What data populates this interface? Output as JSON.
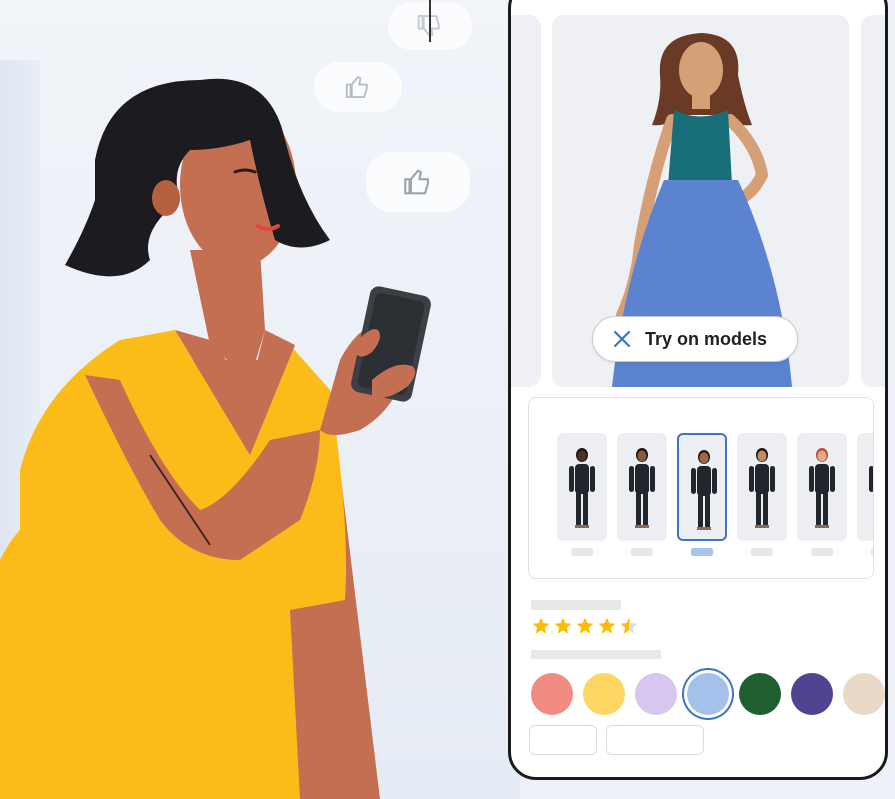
{
  "product": {
    "try_on_label": "Try on models",
    "rating": 4.5,
    "rating_max": 5
  },
  "models": [
    {
      "skin": "#4a3126",
      "hair": "#1b1413",
      "selected": false
    },
    {
      "skin": "#8a5a3c",
      "hair": "#1b1413",
      "selected": false
    },
    {
      "skin": "#a0674a",
      "hair": "#2a1d16",
      "selected": true
    },
    {
      "skin": "#c48a64",
      "hair": "#1b1413",
      "selected": false
    },
    {
      "skin": "#e0a98a",
      "hair": "#b84b2a",
      "selected": false
    },
    {
      "skin": "#7a4d33",
      "hair": "#1b1413",
      "selected": false
    }
  ],
  "color_swatches": [
    {
      "color": "#f28b82",
      "selected": false
    },
    {
      "color": "#fdd663",
      "selected": false
    },
    {
      "color": "#d7c7ee",
      "selected": false
    },
    {
      "color": "#a3c1ea",
      "selected": true
    },
    {
      "color": "#1e5e2f",
      "selected": false
    },
    {
      "color": "#4f4392",
      "selected": false
    },
    {
      "color": "#ead9c8",
      "selected": false
    }
  ],
  "colors": {
    "accent": "#3b74c9",
    "star": "#fbbc04",
    "dress_top": "#176e78",
    "dress_skirt": "#5b83cf",
    "shirt": "#fbbc1a",
    "skin": "#c46f52",
    "hair": "#1c1b1f"
  },
  "icons": [
    "thumbs-down-icon",
    "thumbs-up-icon",
    "close-icon",
    "star-icon"
  ]
}
